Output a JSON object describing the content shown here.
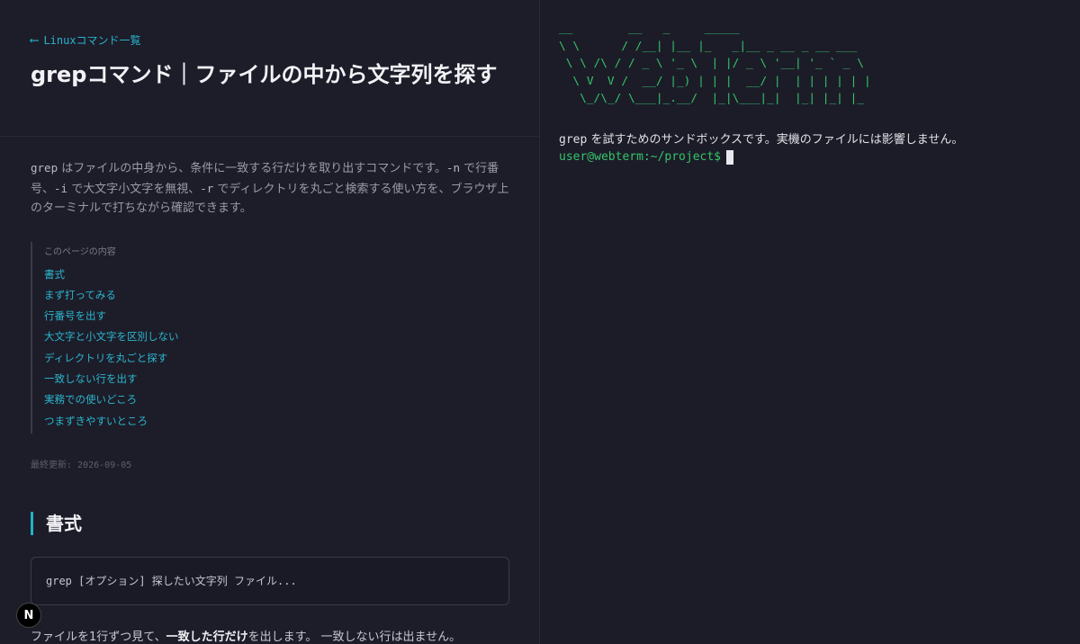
{
  "nav": {
    "back_arrow": "⟵",
    "back_label": "Linuxコマンド一覧"
  },
  "page": {
    "title": "grepコマンド｜ファイルの中から文字列を探す"
  },
  "intro": {
    "cmd": "grep",
    "t1": " はファイルの中身から、条件に一致する行だけを取り出すコマンドです。",
    "opt_n": "-n",
    "t2": " で行番号、",
    "opt_i": "-i",
    "t3": " で大文字小文字を無視、",
    "opt_r": "-r",
    "t4": " でディレクトリを丸ごと検索する使い方を、ブラウザ上のターミナルで打ちながら確認できます。"
  },
  "toc": {
    "title": "このページの内容",
    "items": [
      "書式",
      "まず打ってみる",
      "行番号を出す",
      "大文字と小文字を区別しない",
      "ディレクトリを丸ごと探す",
      "一致しない行を出す",
      "実務での使いどころ",
      "つまずきやすいところ"
    ]
  },
  "updated": "最終更新: 2026-09-05",
  "section": {
    "heading": "書式",
    "code": "grep [オプション] 探したい文字列 ファイル...",
    "para_pre": "ファイルを1行ずつ見て、",
    "para_bold": "一致した行だけ",
    "para_post": "を出します。 一致しない行は出ません。"
  },
  "badge": "N",
  "terminal": {
    "ascii": [
      "__        __   _     _____",
      "\\ \\      / /__| |__ |_   _|__ _ __ _ __ ___",
      " \\ \\ /\\ / / _ \\ '_ \\  | |/ _ \\ '__| '_ ` _ \\",
      "  \\ V  V /  __/ |_) | | |  __/ |  | | | | | |",
      "   \\_/\\_/ \\___|_.__/  |_|\\___|_|  |_| |_| |_"
    ],
    "intro_cmd": "grep",
    "intro_text": " を試すためのサンドボックスです。実機のファイルには影響しません。",
    "prompt": "user@webterm:~/project$"
  }
}
